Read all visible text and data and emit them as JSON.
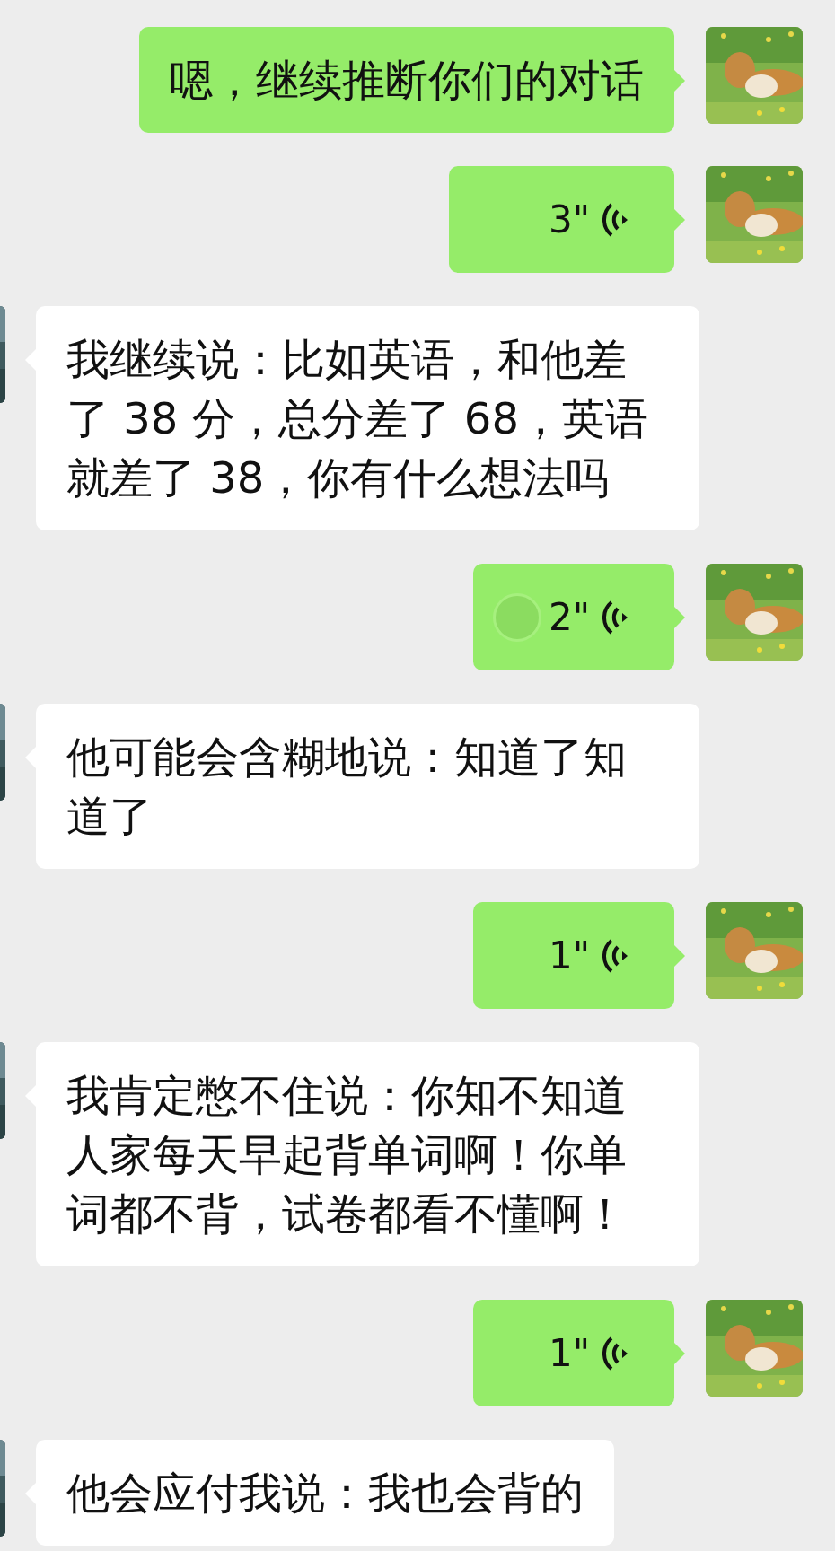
{
  "messages": [
    {
      "outgoing": true,
      "kind": "text",
      "text": "嗯，继续推断你们的对话"
    },
    {
      "outgoing": true,
      "kind": "voice",
      "duration": "3\"",
      "pressed": false
    },
    {
      "outgoing": false,
      "kind": "text",
      "text": "我继续说：比如英语，和他差了 38 分，总分差了 68，英语就差了 38，你有什么想法吗"
    },
    {
      "outgoing": true,
      "kind": "voice",
      "duration": "2\"",
      "pressed": true
    },
    {
      "outgoing": false,
      "kind": "text",
      "text": "他可能会含糊地说：知道了知道了"
    },
    {
      "outgoing": true,
      "kind": "voice",
      "duration": "1\"",
      "pressed": false
    },
    {
      "outgoing": false,
      "kind": "text",
      "text": "我肯定憋不住说：你知不知道人家每天早起背单词啊！你单词都不背，试卷都看不懂啊！"
    },
    {
      "outgoing": true,
      "kind": "voice",
      "duration": "1\"",
      "pressed": false
    },
    {
      "outgoing": false,
      "kind": "text",
      "text": "他会应付我说：我也会背的"
    }
  ]
}
